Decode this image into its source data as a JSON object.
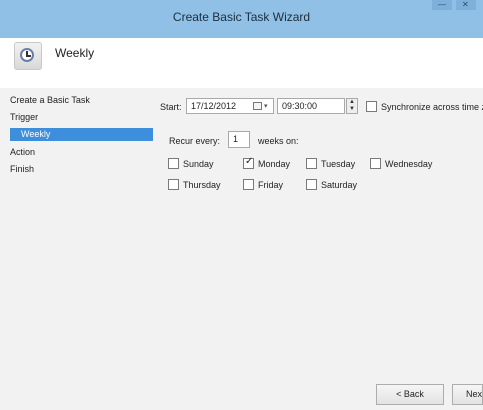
{
  "window": {
    "title": "Create Basic Task Wizard"
  },
  "header": {
    "title": "Weekly"
  },
  "nav": {
    "items": [
      {
        "label": "Create a Basic Task"
      },
      {
        "label": "Trigger"
      },
      {
        "label": "Weekly"
      },
      {
        "label": "Action"
      },
      {
        "label": "Finish"
      }
    ]
  },
  "schedule": {
    "start_label": "Start:",
    "start_date": "17/12/2012",
    "start_time": "09:30:00",
    "sync_label": "Synchronize across time zones",
    "recur_label": "Recur every:",
    "recur_value": "1",
    "recur_suffix": "weeks on:"
  },
  "days": [
    {
      "label": "Sunday",
      "checked": false
    },
    {
      "label": "Monday",
      "checked": true
    },
    {
      "label": "Tuesday",
      "checked": false
    },
    {
      "label": "Wednesday",
      "checked": false
    },
    {
      "label": "Thursday",
      "checked": false
    },
    {
      "label": "Friday",
      "checked": false
    },
    {
      "label": "Saturday",
      "checked": false
    }
  ],
  "buttons": {
    "back": "< Back",
    "next": "Next >"
  },
  "icons": {
    "header_icon": "clock-icon",
    "check": "✓"
  },
  "colors": {
    "titlebar": "#90c0e6",
    "selection": "#3d8fdc"
  }
}
